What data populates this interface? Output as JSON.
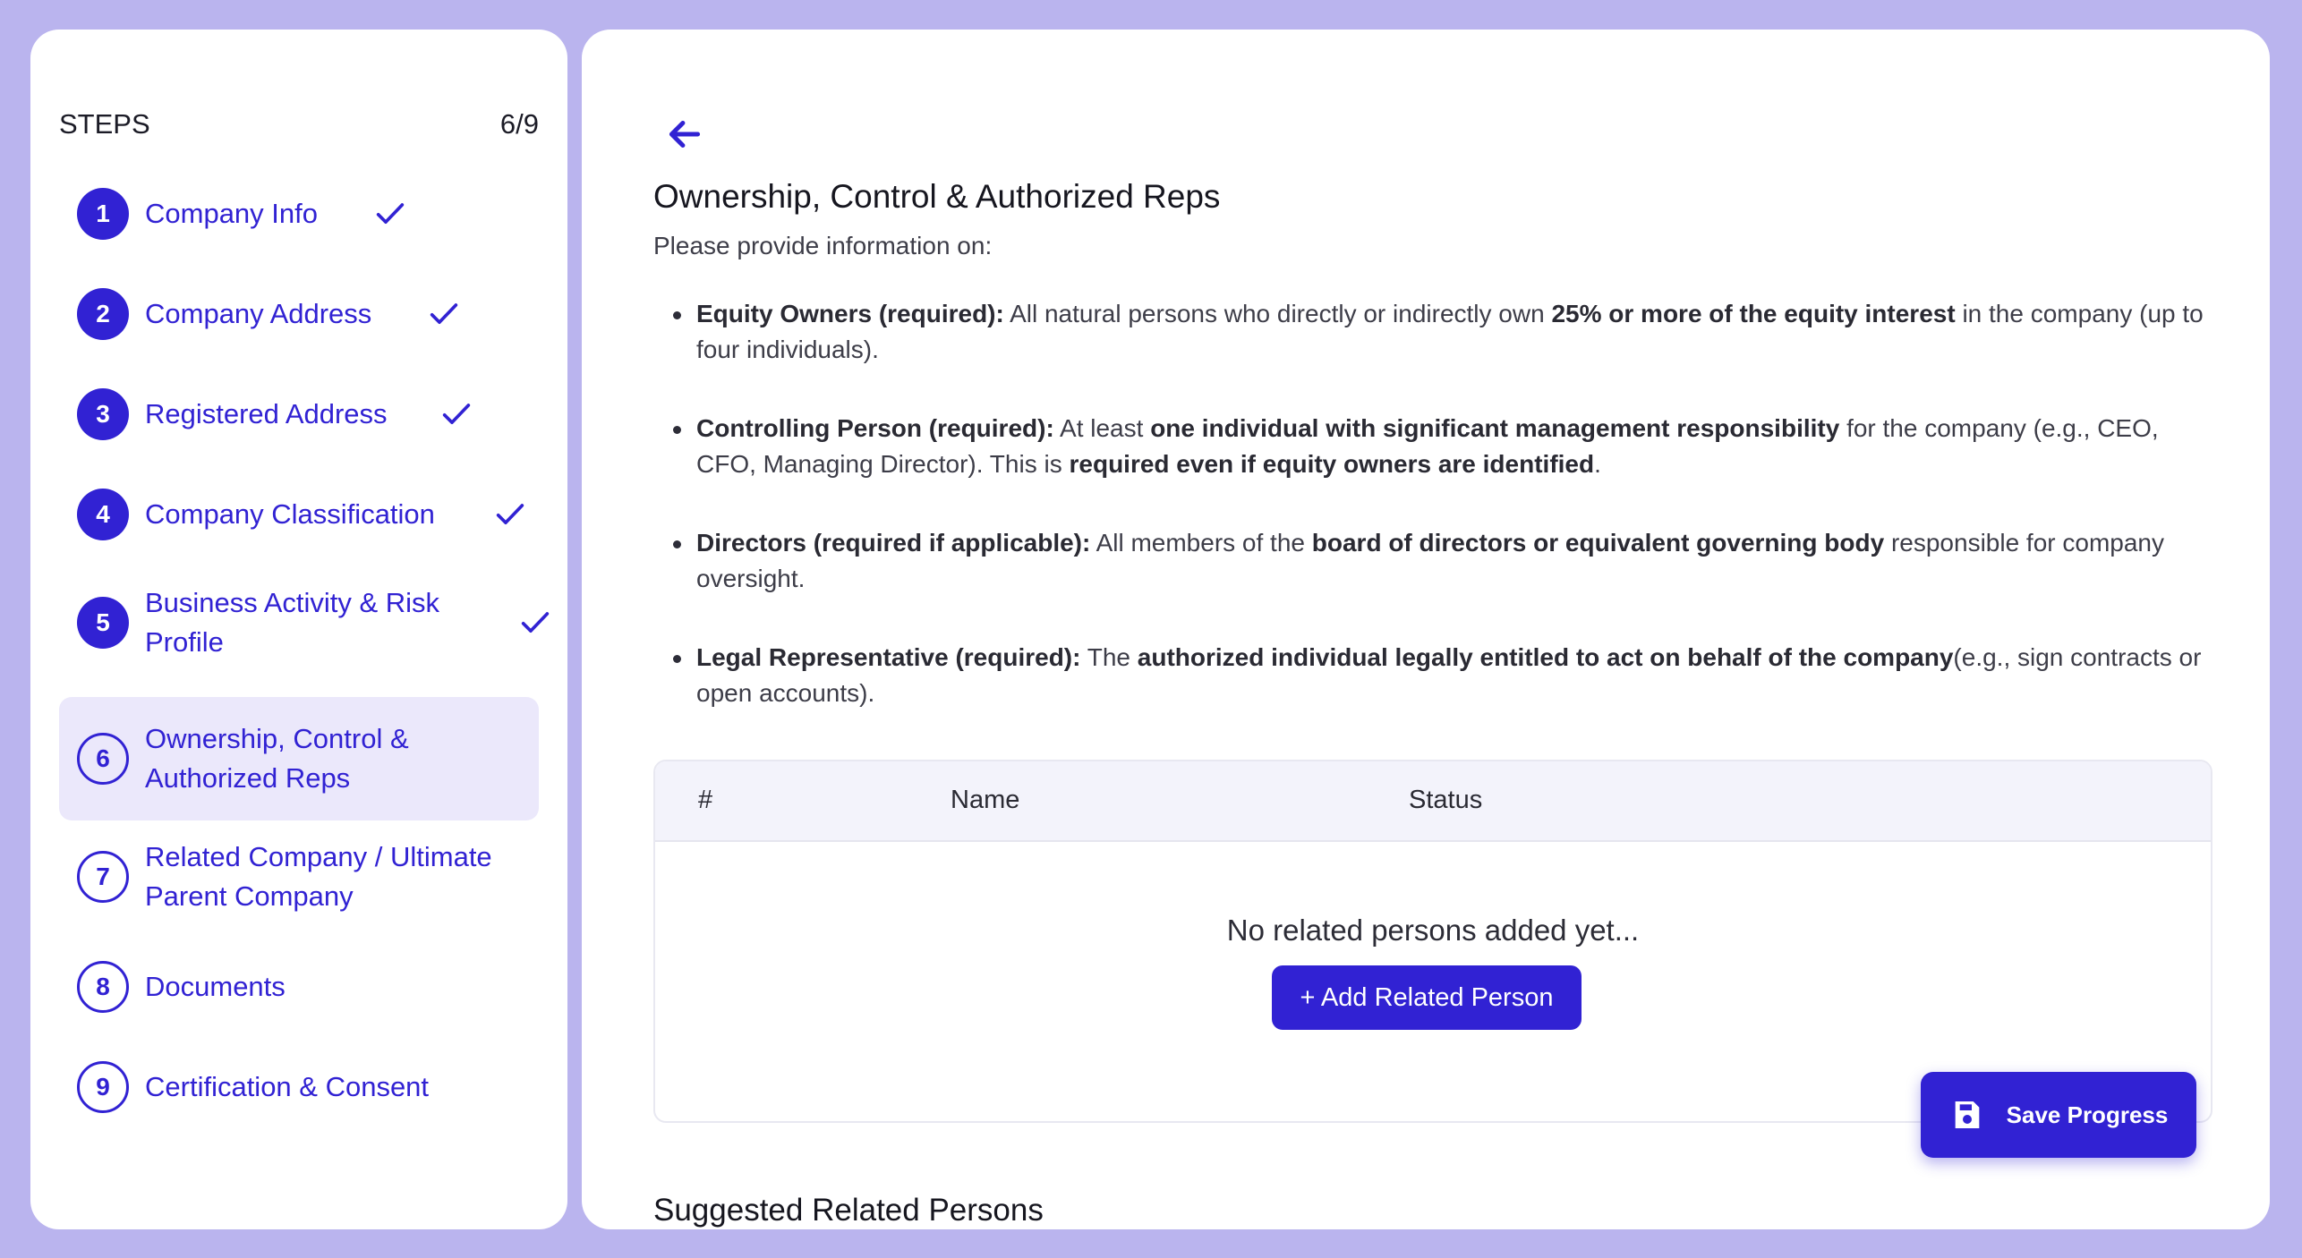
{
  "sidebar": {
    "heading": "STEPS",
    "progress": "6/9",
    "steps": [
      {
        "num": "1",
        "line1": "Company Info",
        "line2": "",
        "done": true
      },
      {
        "num": "2",
        "line1": "Company Address",
        "line2": "",
        "done": true
      },
      {
        "num": "3",
        "line1": "Registered Address",
        "line2": "",
        "done": true
      },
      {
        "num": "4",
        "line1": "Company Classification",
        "line2": "",
        "done": true
      },
      {
        "num": "5",
        "line1": "Business Activity & Risk",
        "line2": "Profile",
        "done": true
      },
      {
        "num": "6",
        "line1": "Ownership, Control &",
        "line2": "Authorized Reps",
        "done": false,
        "active": true
      },
      {
        "num": "7",
        "line1": "Related Company / Ultimate",
        "line2": "Parent Company",
        "done": false
      },
      {
        "num": "8",
        "line1": "Documents",
        "line2": "",
        "done": false
      },
      {
        "num": "9",
        "line1": "Certification & Consent",
        "line2": "",
        "done": false
      }
    ]
  },
  "main": {
    "title": "Ownership, Control & Authorized Reps",
    "intro": "Please provide information on:",
    "requirements": [
      {
        "parts": [
          {
            "b": true,
            "t": "Equity Owners (required):"
          },
          {
            "b": false,
            "t": " All natural persons who directly or indirectly own "
          },
          {
            "b": true,
            "t": "25% or more of the equity interest"
          },
          {
            "b": false,
            "t": " in the company (up to four individuals)."
          }
        ]
      },
      {
        "parts": [
          {
            "b": true,
            "t": "Controlling Person (required):"
          },
          {
            "b": false,
            "t": " At least "
          },
          {
            "b": true,
            "t": "one individual with significant management responsibility"
          },
          {
            "b": false,
            "t": " for the company (e.g., CEO, CFO, Managing Director). This is "
          },
          {
            "b": true,
            "t": "required even if equity owners are identified"
          },
          {
            "b": false,
            "t": "."
          }
        ]
      },
      {
        "parts": [
          {
            "b": true,
            "t": "Directors (required if applicable):"
          },
          {
            "b": false,
            "t": " All members of the "
          },
          {
            "b": true,
            "t": "board of directors or equivalent governing body"
          },
          {
            "b": false,
            "t": " responsible for company oversight."
          }
        ]
      },
      {
        "parts": [
          {
            "b": true,
            "t": "Legal Representative (required):"
          },
          {
            "b": false,
            "t": " The "
          },
          {
            "b": true,
            "t": "authorized individual legally entitled to act on behalf of the company"
          },
          {
            "b": false,
            "t": "(e.g., sign contracts or open accounts)."
          }
        ]
      }
    ],
    "table": {
      "headers": [
        "#",
        "Name",
        "Status"
      ],
      "empty_message": "No related persons added yet...",
      "add_button": "+ Add Related Person"
    },
    "save_button": "Save Progress",
    "suggested_title": "Suggested Related Persons"
  },
  "colors": {
    "background": "#bab4ee",
    "accent": "#3122d3",
    "active_step": "#ebe8fb"
  }
}
